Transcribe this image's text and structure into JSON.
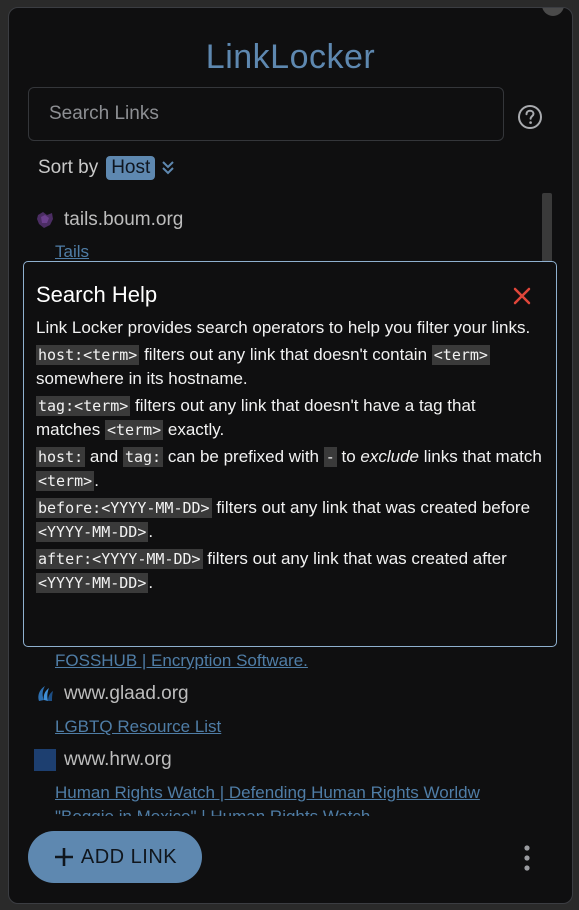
{
  "app": {
    "title": "LinkLocker"
  },
  "search": {
    "placeholder": "Search Links",
    "value": ""
  },
  "sort": {
    "label": "Sort by",
    "value": "Host"
  },
  "links": [
    {
      "host": "tails.boum.org",
      "title": "Tails",
      "favicon": "tails-icon"
    },
    {
      "host": "",
      "title": "FOSSHUB | Encryption Software.",
      "favicon": ""
    },
    {
      "host": "www.glaad.org",
      "title": "LGBTQ Resource List",
      "favicon": "glaad-icon"
    },
    {
      "host": "www.hrw.org",
      "title": "Human Rights Watch | Defending Human Rights Worldw",
      "favicon": "hrw-icon"
    },
    {
      "host": "",
      "title": "\"Boggie in Mexico\" | Human Rights Watch",
      "favicon": ""
    }
  ],
  "help": {
    "title": "Search Help",
    "intro": "Link Locker provides search operators to help you filter your links.",
    "host_op": "host:<term>",
    "host_text_1": " filters out any link that doesn't contain ",
    "host_term": "<term>",
    "host_text_2": " somewhere in its hostname.",
    "tag_op": "tag:<term>",
    "tag_text_1": " filters out any link that doesn't have a tag that matches ",
    "tag_term": "<term>",
    "tag_text_2": " exactly.",
    "prefix_host": "host:",
    "prefix_and": " and ",
    "prefix_tag": "tag:",
    "prefix_text_1": " can be prefixed with ",
    "prefix_dash": "-",
    "prefix_text_2": " to ",
    "prefix_exclude": "exclude",
    "prefix_text_3": " links that match ",
    "prefix_term": "<term>",
    "prefix_text_4": ".",
    "before_op": "before:<YYYY-MM-DD>",
    "before_text_1": " filters out any link that was created before ",
    "before_term": "<YYYY-MM-DD>",
    "before_text_2": ".",
    "after_op": "after:<YYYY-MM-DD>",
    "after_text_1": " filters out any link that was created after ",
    "after_term": "<YYYY-MM-DD>",
    "after_text_2": "."
  },
  "actions": {
    "add_link": "ADD LINK"
  },
  "colors": {
    "accent": "#5e88b0",
    "link": "#4f7da6",
    "close": "#e0463a",
    "background": "#0f0f10"
  }
}
